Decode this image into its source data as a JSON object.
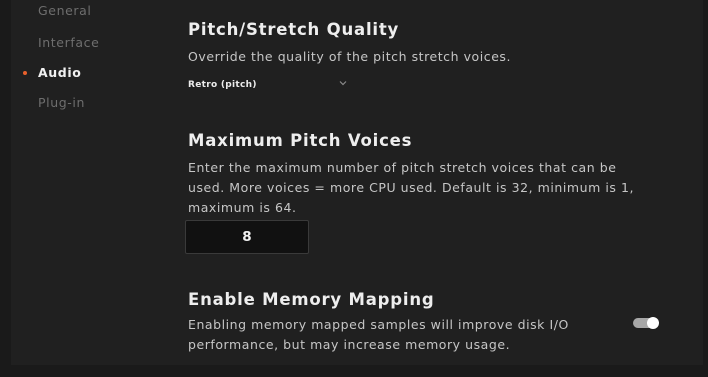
{
  "sidebar": {
    "items": [
      {
        "label": "General",
        "active": false
      },
      {
        "label": "Interface",
        "active": false
      },
      {
        "label": "Audio",
        "active": true
      },
      {
        "label": "Plug-in",
        "active": false
      }
    ]
  },
  "pitch_quality": {
    "title": "Pitch/Stretch Quality",
    "description": "Override the quality of the pitch stretch voices.",
    "selected": "Retro (pitch)"
  },
  "max_voices": {
    "title": "Maximum Pitch Voices",
    "description_lines": [
      "Enter the maximum number of pitch stretch voices that can be",
      "used. More voices = more CPU used. Default is 32, minimum is 1,",
      "maximum is 64."
    ],
    "value": "8"
  },
  "memory_mapping": {
    "title": "Enable Memory Mapping",
    "description_lines": [
      "Enabling memory mapped samples will improve disk I/O",
      "performance, but may increase memory usage."
    ],
    "enabled": true
  },
  "colors": {
    "accent": "#e8602c",
    "background": "#202020",
    "toggle_track": "#a7a7a7"
  }
}
